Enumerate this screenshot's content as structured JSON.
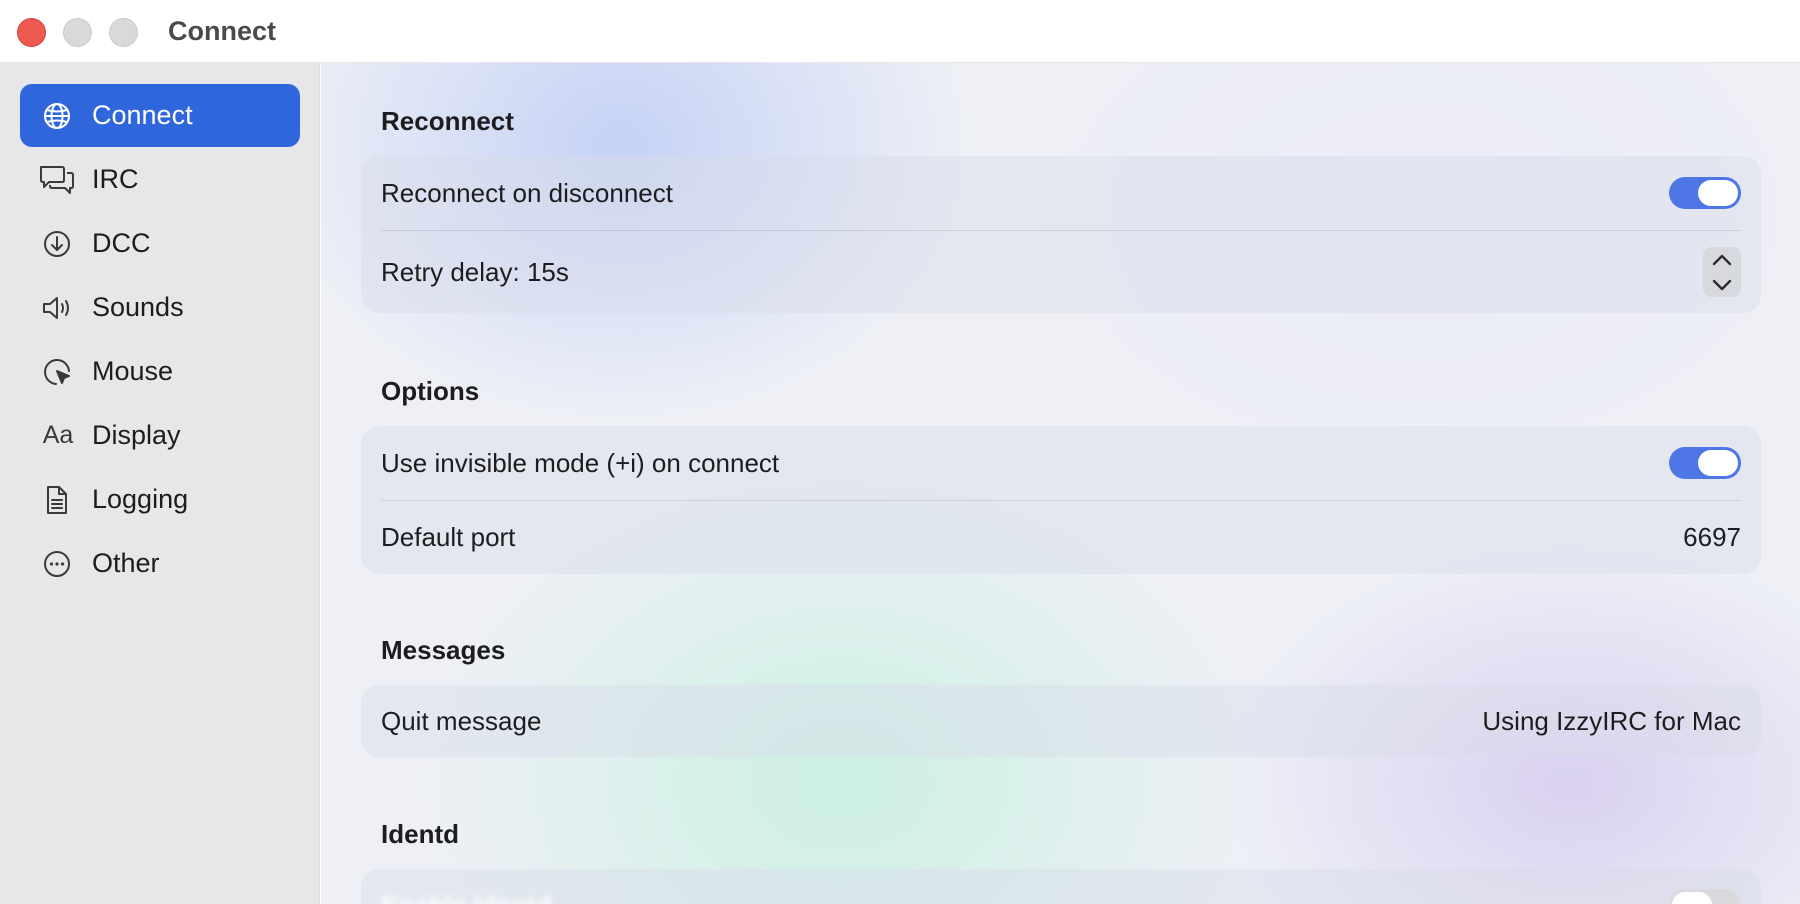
{
  "window": {
    "title": "Connect"
  },
  "sidebar": {
    "items": [
      {
        "label": "Connect",
        "icon": "globe-icon",
        "active": true
      },
      {
        "label": "IRC",
        "icon": "chat-bubbles-icon",
        "active": false
      },
      {
        "label": "DCC",
        "icon": "download-circle-icon",
        "active": false
      },
      {
        "label": "Sounds",
        "icon": "speaker-icon",
        "active": false
      },
      {
        "label": "Mouse",
        "icon": "cursor-icon",
        "active": false
      },
      {
        "label": "Display",
        "icon": "text-aa-icon",
        "active": false,
        "glyph": "Aa"
      },
      {
        "label": "Logging",
        "icon": "document-icon",
        "active": false
      },
      {
        "label": "Other",
        "icon": "ellipsis-circle-icon",
        "active": false
      }
    ]
  },
  "sections": {
    "reconnect": {
      "title": "Reconnect",
      "reconnect_on_disconnect": {
        "label": "Reconnect on disconnect",
        "on": true
      },
      "retry_delay": {
        "label": "Retry delay: 15s"
      }
    },
    "options": {
      "title": "Options",
      "invisible_mode": {
        "label": "Use invisible mode (+i) on connect",
        "on": true
      },
      "default_port": {
        "label": "Default port",
        "value": "6697"
      }
    },
    "messages": {
      "title": "Messages",
      "quit_message": {
        "label": "Quit message",
        "value": "Using IzzyIRC for Mac"
      }
    },
    "identd": {
      "title": "Identd",
      "enable_identd": {
        "label": "Enable Identd",
        "on": false
      }
    }
  },
  "colors": {
    "accent": "#2f66dc",
    "toggle_on": "#4f76e6",
    "close_button": "#ee5a52"
  }
}
